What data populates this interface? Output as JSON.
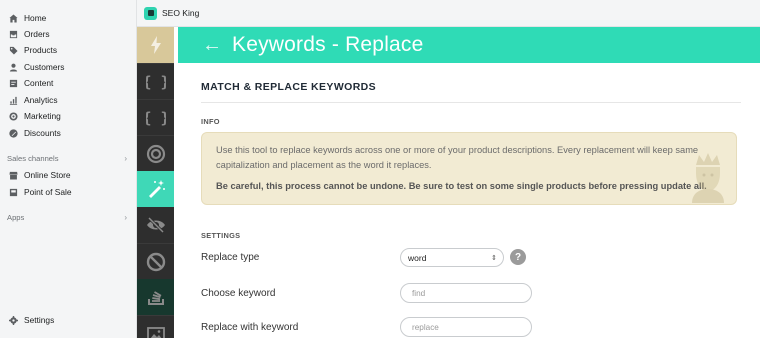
{
  "shop_nav": {
    "items": [
      {
        "label": "Home",
        "icon": "home-icon"
      },
      {
        "label": "Orders",
        "icon": "orders-icon"
      },
      {
        "label": "Products",
        "icon": "tag-icon"
      },
      {
        "label": "Customers",
        "icon": "person-icon"
      },
      {
        "label": "Content",
        "icon": "content-icon"
      },
      {
        "label": "Analytics",
        "icon": "chart-icon"
      },
      {
        "label": "Marketing",
        "icon": "target-icon"
      },
      {
        "label": "Discounts",
        "icon": "discount-icon"
      }
    ],
    "sales_channels_label": "Sales channels",
    "sales_channels": [
      {
        "label": "Online Store",
        "icon": "store-icon"
      },
      {
        "label": "Point of Sale",
        "icon": "pos-icon"
      }
    ],
    "apps_label": "Apps",
    "settings_label": "Settings"
  },
  "app": {
    "name": "SEO King"
  },
  "rail": {
    "items": [
      {
        "icon": "lightning-icon",
        "state": "first"
      },
      {
        "icon": "braces-icon"
      },
      {
        "icon": "braces-icon"
      },
      {
        "icon": "target-icon"
      },
      {
        "icon": "magic-wand-icon",
        "state": "active"
      },
      {
        "icon": "eye-slash-icon"
      },
      {
        "icon": "no-icon"
      },
      {
        "icon": "stack-icon",
        "state": "stack"
      },
      {
        "icon": "image-icon"
      }
    ]
  },
  "page": {
    "title": "Keywords - Replace",
    "section_title": "MATCH & REPLACE KEYWORDS",
    "info_label": "INFO",
    "info_text": "Use this tool to replace keywords across one or more of your product descriptions. Every replacement will keep same capitalization and placement as the word it replaces.",
    "info_warning": "Be careful, this process cannot be undone. Be sure to test on some single products before pressing update all.",
    "settings_label": "SETTINGS",
    "replace_type_label": "Replace type",
    "replace_type_value": "word",
    "choose_keyword_label": "Choose keyword",
    "choose_keyword_placeholder": "find",
    "replace_with_label": "Replace with keyword",
    "replace_with_placeholder": "replace"
  }
}
